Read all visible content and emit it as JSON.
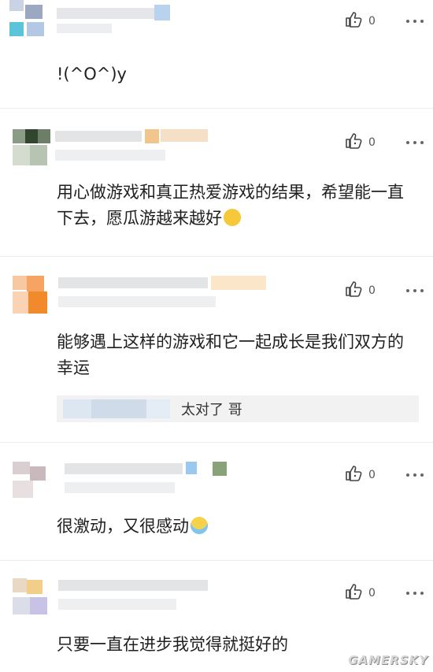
{
  "comments": [
    {
      "like_count": "0",
      "text": "!(^O^)y"
    },
    {
      "like_count": "0",
      "text": "用心做游戏和真正热爱游戏的结果，希望能一直下去，愿瓜游越来越好"
    },
    {
      "like_count": "0",
      "text": "能够遇上这样的游戏和它一起成长是我们双方的幸运",
      "reply": {
        "text": "太对了 哥"
      }
    },
    {
      "like_count": "0",
      "text": "很激动，又很感动"
    },
    {
      "like_count": "0",
      "text": "只要一直在进步我觉得就挺好的"
    }
  ],
  "icons": {
    "like": "thumbs-up-icon",
    "more": "more-dots-icon"
  },
  "watermark": "GAMERSKY"
}
